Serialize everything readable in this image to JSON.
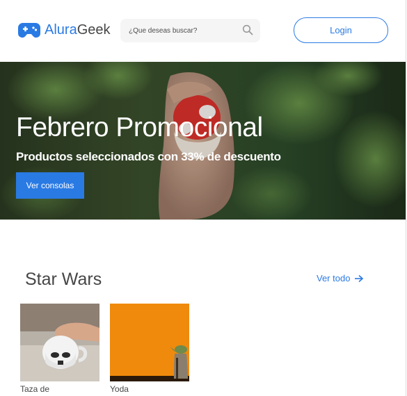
{
  "header": {
    "logo_part1": "Alura",
    "logo_part2": "Geek",
    "search_placeholder": "¿Que deseas buscar?",
    "login_label": "Login"
  },
  "hero": {
    "title": "Febrero Promocional",
    "subtitle": "Productos seleccionados con 33% de descuento",
    "button_label": "Ver consolas"
  },
  "section": {
    "title": "Star Wars",
    "view_all_label": "Ver todo",
    "products": [
      {
        "name": "Taza de"
      },
      {
        "name": "Yoda"
      }
    ]
  },
  "colors": {
    "accent": "#2a7ae4",
    "text": "#464646",
    "search_bg": "#f5f5f5"
  }
}
